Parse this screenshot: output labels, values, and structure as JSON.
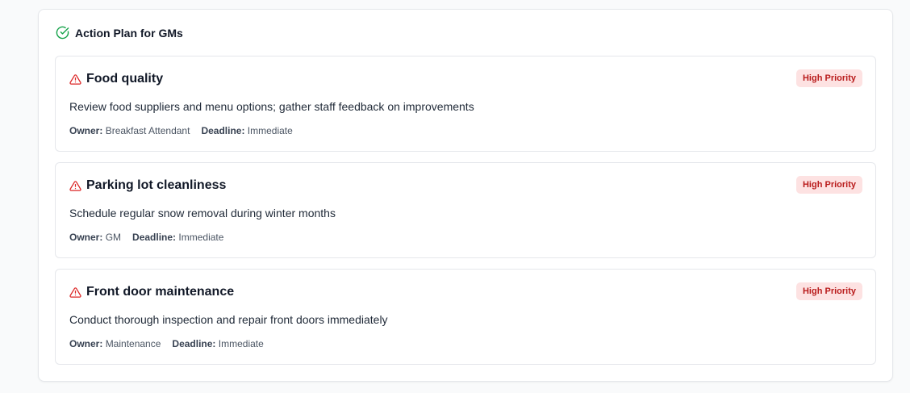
{
  "panel": {
    "title": "Action Plan for GMs",
    "icon": "check-circle-icon",
    "accent": "#16a34a"
  },
  "labels": {
    "owner": "Owner:",
    "deadline": "Deadline:"
  },
  "colors": {
    "priority_bg": "#fde2e2",
    "priority_text": "#b91c1c",
    "warning_icon": "#dc2626"
  },
  "actions": [
    {
      "icon": "warning-triangle-icon",
      "title": "Food quality",
      "priority": "High Priority",
      "description": "Review food suppliers and menu options; gather staff feedback on improvements",
      "owner": "Breakfast Attendant",
      "deadline": "Immediate"
    },
    {
      "icon": "warning-triangle-icon",
      "title": "Parking lot cleanliness",
      "priority": "High Priority",
      "description": "Schedule regular snow removal during winter months",
      "owner": "GM",
      "deadline": "Immediate"
    },
    {
      "icon": "warning-triangle-icon",
      "title": "Front door maintenance",
      "priority": "High Priority",
      "description": "Conduct thorough inspection and repair front doors immediately",
      "owner": "Maintenance",
      "deadline": "Immediate"
    }
  ]
}
